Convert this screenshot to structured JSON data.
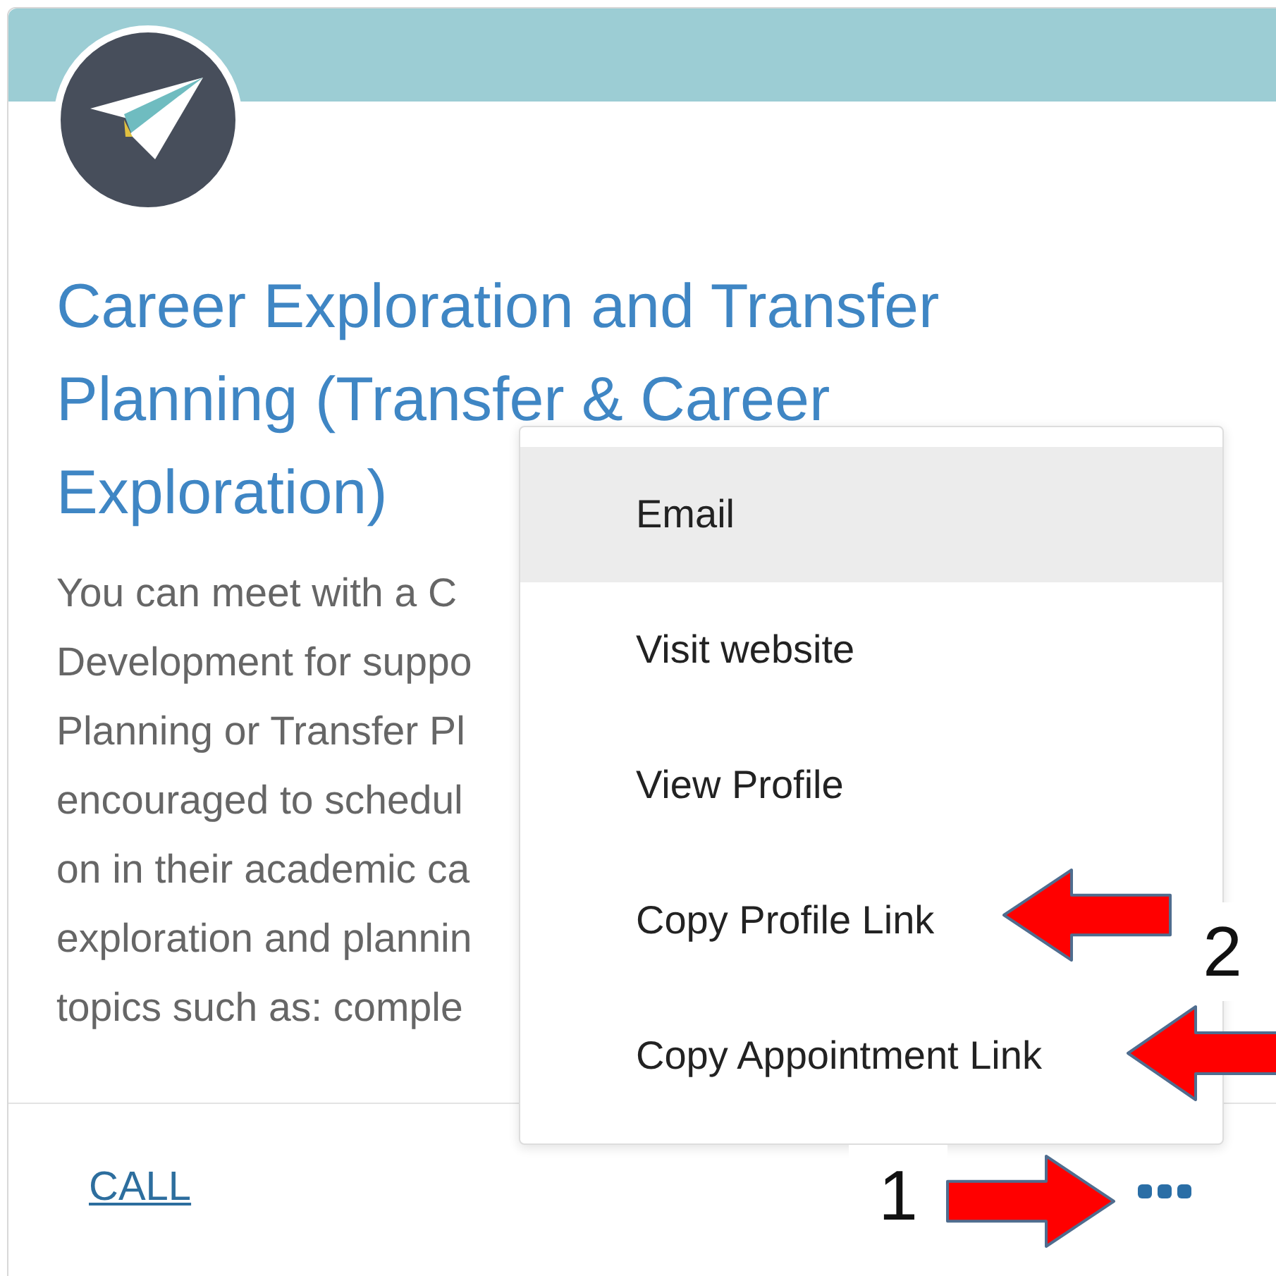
{
  "card": {
    "title_lines": [
      "Career Exploration and Transfer",
      "Planning (Transfer & Career",
      "Exploration)"
    ],
    "description_lines": [
      "You can meet with a C",
      "Development for suppo",
      "Planning or Transfer Pl",
      "encouraged to schedul",
      "on in their academic ca",
      "exploration and plannin",
      "topics such as: comple"
    ],
    "footer": {
      "call_link": "CALL"
    }
  },
  "menu": {
    "items": [
      {
        "label": "Email",
        "highlighted": true
      },
      {
        "label": "Visit website",
        "highlighted": false
      },
      {
        "label": "View Profile",
        "highlighted": false
      },
      {
        "label": "Copy Profile Link",
        "highlighted": false
      },
      {
        "label": "Copy Appointment Link",
        "highlighted": false
      }
    ]
  },
  "annotations": [
    {
      "label": "2"
    },
    {
      "label": "1"
    }
  ]
}
